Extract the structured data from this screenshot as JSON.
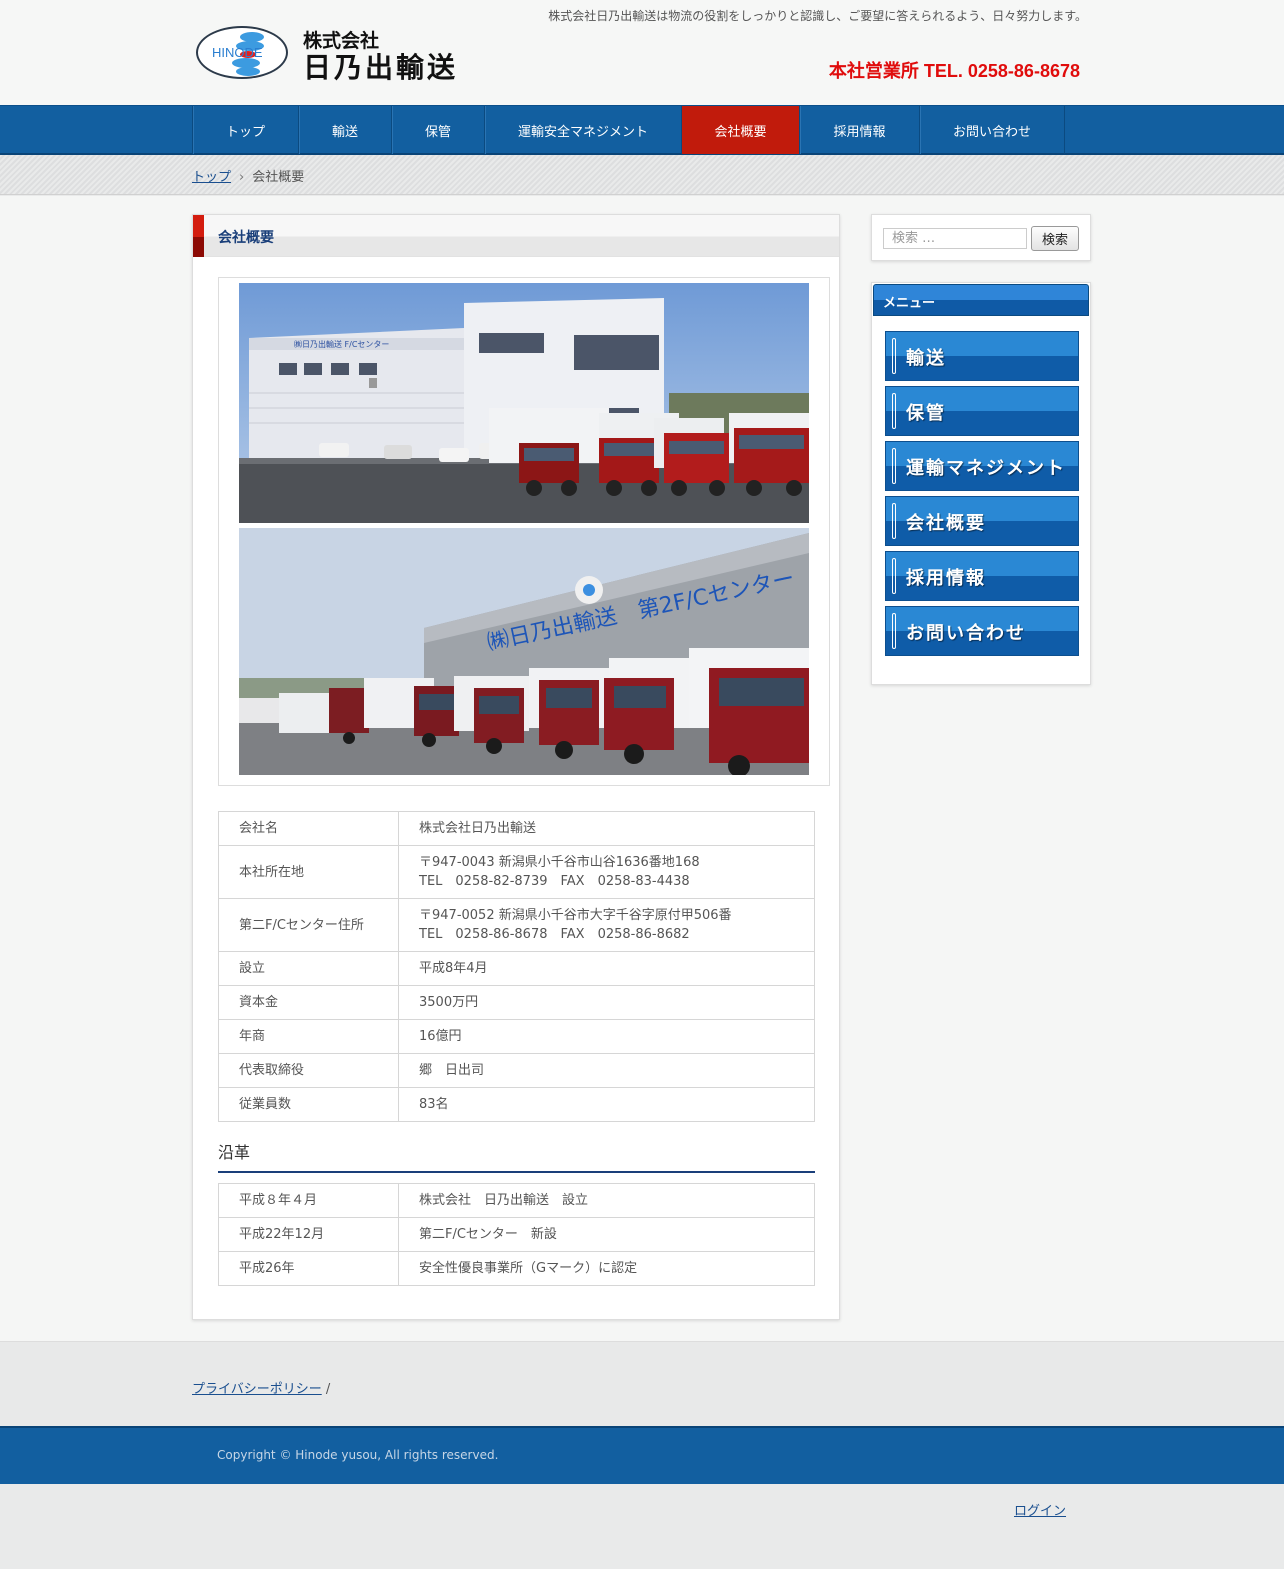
{
  "header": {
    "logo_mark_text": "HINODE",
    "logo_line1": "株式会社",
    "logo_line2": "日乃出輸送",
    "tagline": "株式会社日乃出輸送は物流の役割をしっかりと認識し、ご要望に答えられるよう、日々努力します。",
    "phone": "本社営業所 TEL. 0258-86-8678"
  },
  "nav": {
    "items": [
      {
        "label": "トップ"
      },
      {
        "label": "輸送"
      },
      {
        "label": "保管"
      },
      {
        "label": "運輸安全マネジメント"
      },
      {
        "label": "会社概要"
      },
      {
        "label": "採用情報"
      },
      {
        "label": "お問い合わせ"
      }
    ],
    "active": "会社概要"
  },
  "breadcrumb": {
    "home": "トップ",
    "separator": "›",
    "current": "会社概要"
  },
  "main": {
    "title": "会社概要",
    "company_info": [
      {
        "key": "会社名",
        "value": [
          "株式会社日乃出輸送"
        ]
      },
      {
        "key": "本社所在地",
        "value": [
          "〒947-0043 新潟県小千谷市山谷1636番地168",
          "TEL　0258-82-8739　FAX　0258-83-4438"
        ]
      },
      {
        "key": "第二F/Cセンター住所",
        "value": [
          "〒947-0052 新潟県小千谷市大字千谷字原付甲506番",
          "TEL　0258-86-8678　FAX　0258-86-8682"
        ]
      },
      {
        "key": "設立",
        "value": [
          "平成8年4月"
        ]
      },
      {
        "key": "資本金",
        "value": [
          "3500万円"
        ]
      },
      {
        "key": "年商",
        "value": [
          "16億円"
        ]
      },
      {
        "key": "代表取締役",
        "value": [
          "郷　日出司"
        ]
      },
      {
        "key": "従業員数",
        "value": [
          "83名"
        ]
      }
    ],
    "history_heading": "沿革",
    "history": [
      {
        "date": "平成８年４月",
        "event": "株式会社　日乃出輸送　設立"
      },
      {
        "date": "平成22年12月",
        "event": "第二F/Cセンター　新設"
      },
      {
        "date": "平成26年",
        "event": "安全性優良事業所（Gマーク）に認定"
      }
    ]
  },
  "sidebar": {
    "search_placeholder": "検索 …",
    "search_button": "検索",
    "menu_title": "メニュー",
    "menu_items": [
      {
        "label": "輸送"
      },
      {
        "label": "保管"
      },
      {
        "label": "運輸マネジメント"
      },
      {
        "label": "会社概要"
      },
      {
        "label": "採用情報"
      },
      {
        "label": "お問い合わせ"
      }
    ]
  },
  "footer": {
    "privacy": "プライバシーポリシー",
    "privacy_sep": "/",
    "copyright": "Copyright © Hinode yusou, All rights reserved.",
    "login": "ログイン"
  },
  "colors": {
    "nav_blue": "#125fa0",
    "active_red": "#c11b0c",
    "phone_red": "#e00c0c",
    "title_navy": "#1a3f7a"
  },
  "photos": {
    "sign_center": "㈱日乃出輸送 F/Cセンター",
    "sign_building": "㈱日乃出輸送　第2F/Cセンター"
  }
}
